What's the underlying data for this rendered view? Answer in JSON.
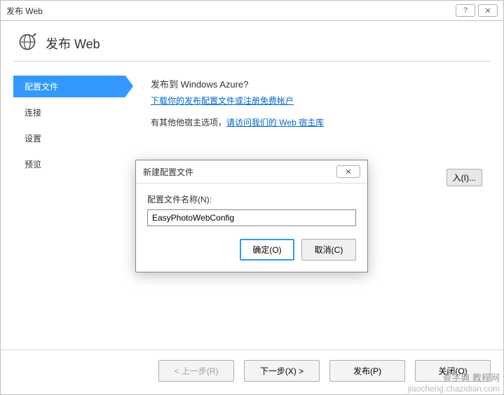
{
  "titlebar": {
    "title": "发布 Web",
    "help_glyph": "?",
    "close_glyph": "✕"
  },
  "header": {
    "title": "发布 Web"
  },
  "sidebar": {
    "items": [
      {
        "label": "配置文件",
        "active": true
      },
      {
        "label": "连接",
        "active": false
      },
      {
        "label": "设置",
        "active": false
      },
      {
        "label": "预览",
        "active": false
      }
    ]
  },
  "main": {
    "heading": "发布到 Windows Azure?",
    "download_link": "下载你的发布配置文件或注册免费帐户",
    "other_host_text": "有其他他宿主选项，",
    "other_host_link": "请访问我们的 Web 宿主库",
    "import_button": "入(I)..."
  },
  "modal": {
    "title": "新建配置文件",
    "close_glyph": "✕",
    "label": "配置文件名称(N):",
    "value": "EasyPhotoWebConfig",
    "ok_button": "确定(O)",
    "cancel_button": "取消(C)"
  },
  "footer": {
    "prev_button": "< 上一步(R)",
    "next_button": "下一步(X) >",
    "publish_button": "发布(P)",
    "close_button": "关闭(O)"
  },
  "watermark": {
    "line1": "查字典 教程网",
    "line2": "jiaocheng.chazidian.com"
  }
}
